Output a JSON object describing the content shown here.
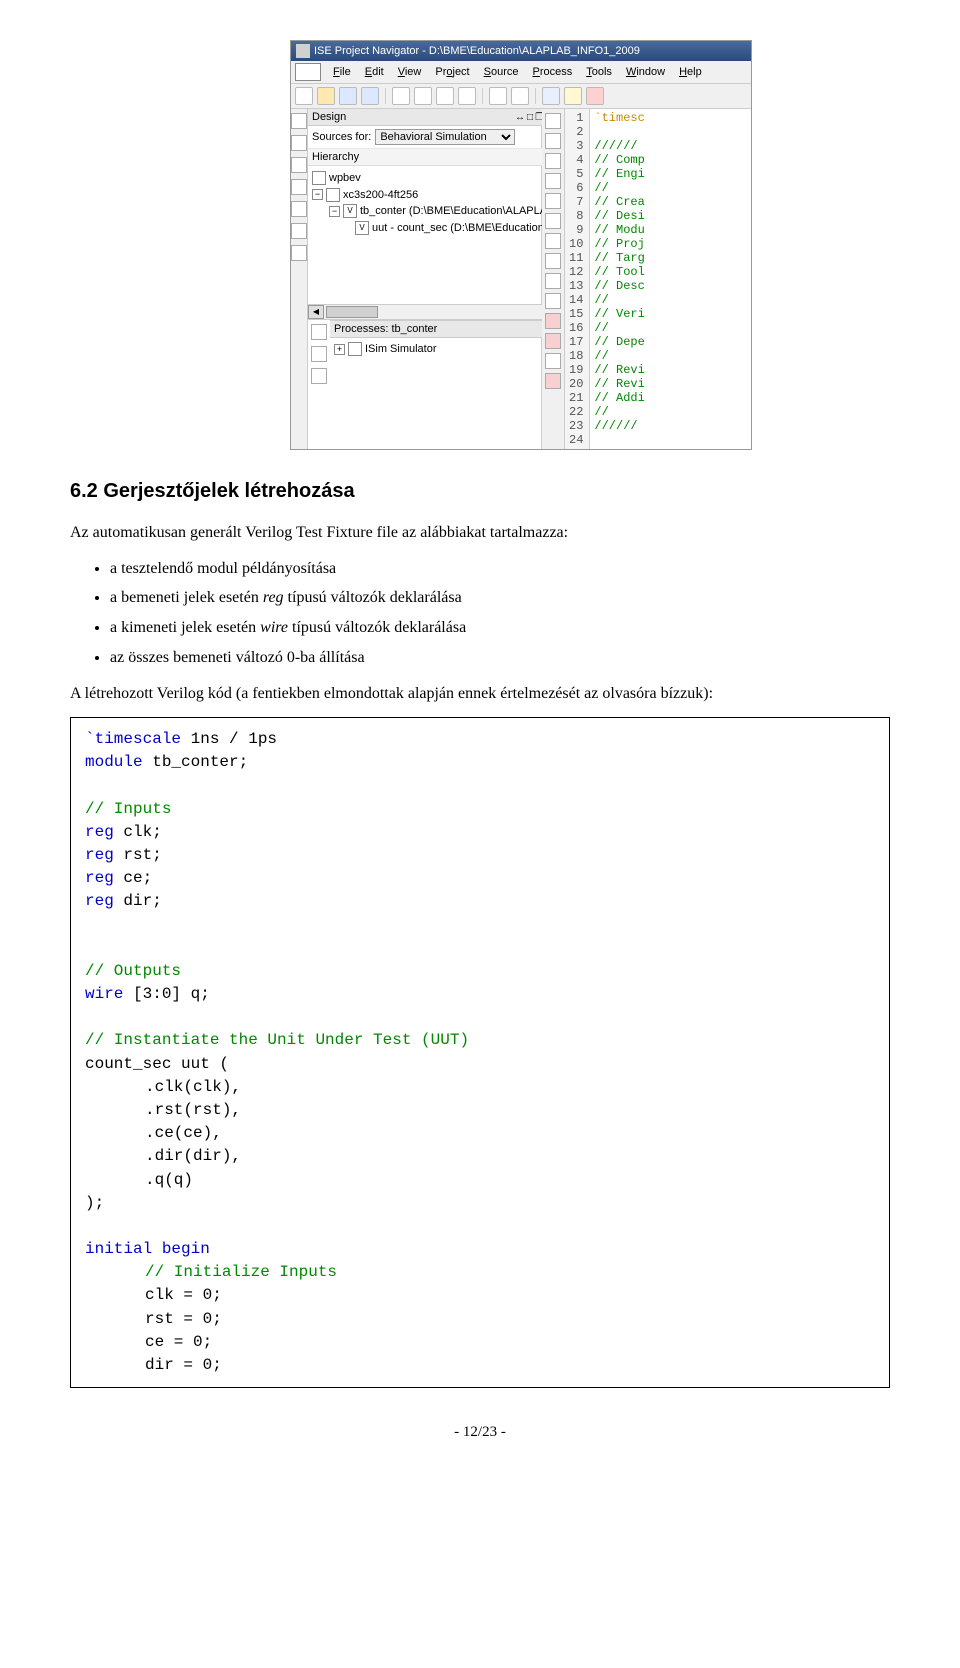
{
  "screenshot": {
    "title": "ISE Project Navigator - D:\\BME\\Education\\ALAPLAB_INFO1_2009",
    "menu": [
      "File",
      "Edit",
      "View",
      "Project",
      "Source",
      "Process",
      "Tools",
      "Window",
      "Help"
    ],
    "design_label": "Design",
    "sources_for_label": "Sources for:",
    "sources_for_value": "Behavioral Simulation",
    "hierarchy_label": "Hierarchy",
    "tree": {
      "root": "wpbev",
      "chip": "xc3s200-4ft256",
      "tb": "tb_conter (D:\\BME\\Education\\ALAPLAB",
      "uut": "uut - count_sec (D:\\BME\\Education"
    },
    "processes_label": "Processes: tb_conter",
    "process_item": "ISim Simulator",
    "code_lines": [
      {
        "n": 1,
        "t": "`timesc",
        "cls": "c-keyword"
      },
      {
        "n": 2,
        "t": "",
        "cls": ""
      },
      {
        "n": 3,
        "t": "//////",
        "cls": "c-comment"
      },
      {
        "n": 4,
        "t": "// Comp",
        "cls": "c-comment"
      },
      {
        "n": 5,
        "t": "// Engi",
        "cls": "c-comment"
      },
      {
        "n": 6,
        "t": "//",
        "cls": "c-comment"
      },
      {
        "n": 7,
        "t": "// Crea",
        "cls": "c-comment"
      },
      {
        "n": 8,
        "t": "// Desi",
        "cls": "c-comment"
      },
      {
        "n": 9,
        "t": "// Modu",
        "cls": "c-comment"
      },
      {
        "n": 10,
        "t": "// Proj",
        "cls": "c-comment"
      },
      {
        "n": 11,
        "t": "// Targ",
        "cls": "c-comment"
      },
      {
        "n": 12,
        "t": "// Tool",
        "cls": "c-comment"
      },
      {
        "n": 13,
        "t": "// Desc",
        "cls": "c-comment"
      },
      {
        "n": 14,
        "t": "//",
        "cls": "c-comment"
      },
      {
        "n": 15,
        "t": "// Veri",
        "cls": "c-comment"
      },
      {
        "n": 16,
        "t": "//",
        "cls": "c-comment"
      },
      {
        "n": 17,
        "t": "// Depe",
        "cls": "c-comment"
      },
      {
        "n": 18,
        "t": "//",
        "cls": "c-comment"
      },
      {
        "n": 19,
        "t": "// Revi",
        "cls": "c-comment"
      },
      {
        "n": 20,
        "t": "// Revi",
        "cls": "c-comment"
      },
      {
        "n": 21,
        "t": "// Addi",
        "cls": "c-comment"
      },
      {
        "n": 22,
        "t": "//",
        "cls": "c-comment"
      },
      {
        "n": 23,
        "t": "//////",
        "cls": "c-comment"
      },
      {
        "n": 24,
        "t": "",
        "cls": ""
      }
    ]
  },
  "heading": "6.2  Gerjesztőjelek létrehozása",
  "intro": "Az automatikusan generált Verilog Test Fixture file az alábbiakat tartalmazza:",
  "bullets": [
    "a tesztelendő modul példányosítása",
    "a bemeneti jelek esetén reg típusú változók deklarálása",
    "a kimeneti jelek esetén wire típusú változók deklarálása",
    "az összes bemeneti változó 0-ba állítása"
  ],
  "after_bullets": "A létrehozott Verilog kód (a fentiekben elmondottak alapján ennek értelmezését az olvasóra bízzuk):",
  "code": {
    "l1a": "`timescale",
    "l1b": " 1ns / 1ps",
    "l2a": "module",
    "l2b": " tb_conter;",
    "l3": "// Inputs",
    "l4a": "reg",
    "l4b": " clk;",
    "l5a": "reg",
    "l5b": " rst;",
    "l6a": "reg",
    "l6b": " ce;",
    "l7a": "reg",
    "l7b": " dir;",
    "l8": "// Outputs",
    "l9a": "wire",
    "l9b": " [3:0] q;",
    "l10": "// Instantiate the Unit Under Test (UUT)",
    "l11": "count_sec uut (",
    "l12": ".clk(clk),",
    "l13": ".rst(rst),",
    "l14": ".ce(ce),",
    "l15": ".dir(dir),",
    "l16": ".q(q)",
    "l17": ");",
    "l18a": "initial",
    "l18b": "begin",
    "l19": "// Initialize Inputs",
    "l20": "clk = 0;",
    "l21": "rst = 0;",
    "l22": "ce = 0;",
    "l23": "dir = 0;"
  },
  "pagenum": "- 12/23 -"
}
